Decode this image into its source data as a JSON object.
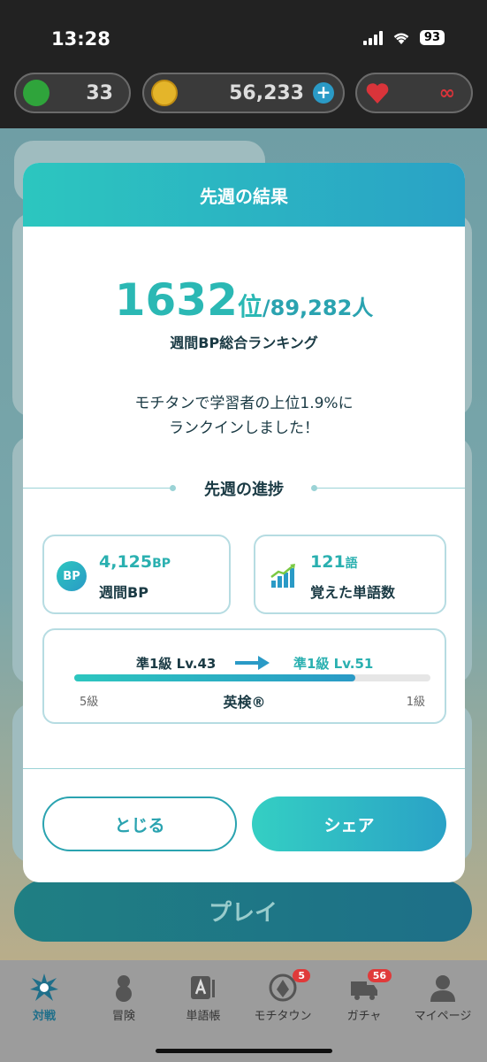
{
  "status": {
    "time": "13:28",
    "battery": "93"
  },
  "resources": {
    "leaves": "33",
    "coins": "56,233",
    "hearts": "∞"
  },
  "background": {
    "play_label": "プレイ"
  },
  "modal": {
    "title": "先週の結果",
    "rank": {
      "number": "1632",
      "unit": "位",
      "total": "/89,282人"
    },
    "rank_label": "週間BP総合ランキング",
    "message_line1": "モチタンで学習者の上位1.9%に",
    "message_line2": "ランクインしました！",
    "progress_title": "先週の進捗",
    "weekly_bp": {
      "value": "4,125",
      "unit": "BP",
      "label": "週間BP",
      "icon_text": "BP"
    },
    "words": {
      "value": "121",
      "unit": "語",
      "label": "覚えた単語数"
    },
    "level": {
      "from": "準1級 Lv.43",
      "to": "準1級 Lv.51",
      "min": "5級",
      "max": "1級",
      "exam": "英検®",
      "progress": 0.79
    },
    "close_label": "とじる",
    "share_label": "シェア"
  },
  "tabs": [
    {
      "label": "対戦",
      "icon": "battle-icon",
      "active": true
    },
    {
      "label": "冒険",
      "icon": "adventure-icon"
    },
    {
      "label": "単語帳",
      "icon": "wordbook-icon"
    },
    {
      "label": "モチタウン",
      "icon": "town-icon",
      "badge": "5"
    },
    {
      "label": "ガチャ",
      "icon": "gacha-icon",
      "badge": "56"
    },
    {
      "label": "マイページ",
      "icon": "profile-icon"
    }
  ],
  "colors": {
    "accent": "#2bb8b4",
    "header_start": "#2cc6bf",
    "header_end": "#2aa2c6",
    "text_dark": "#1a3a44"
  }
}
